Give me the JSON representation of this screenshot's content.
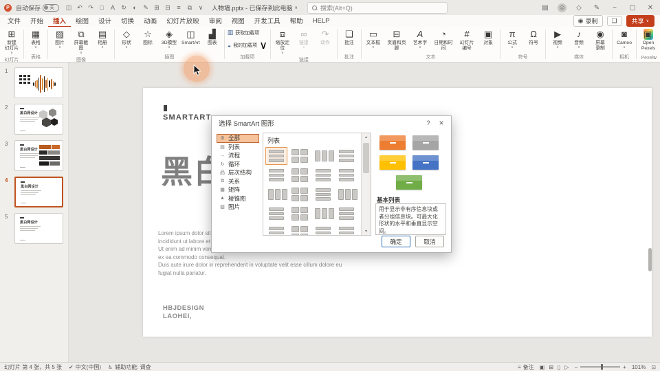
{
  "colors": {
    "accent": "#c43e1c",
    "selection": "#c0531f",
    "category_highlight": "#f6c39d",
    "dialog_primary_border": "#2f6fb8"
  },
  "titlebar": {
    "app_logo_letter": "P",
    "autosave_label": "自动保存",
    "autosave_state": "关",
    "quick_icons": [
      {
        "name": "save",
        "glyph": "◫"
      },
      {
        "name": "undo",
        "glyph": "↶"
      },
      {
        "name": "redo",
        "glyph": "↷"
      },
      {
        "name": "shape",
        "glyph": "□"
      },
      {
        "name": "text-box",
        "glyph": "A"
      },
      {
        "name": "rotate",
        "glyph": "↻"
      },
      {
        "name": "fill-color",
        "glyph": "◐"
      },
      {
        "name": "format-painter",
        "glyph": "✎"
      },
      {
        "name": "grid-view",
        "glyph": "⊞"
      },
      {
        "name": "guides",
        "glyph": "⊟"
      },
      {
        "name": "align",
        "glyph": "≡"
      },
      {
        "name": "arrange",
        "glyph": "⧉"
      },
      {
        "name": "more-commands",
        "glyph": "∨"
      }
    ],
    "doc_title": "人物墙.pptx - 已保存到此电脑",
    "doc_title_chevron": "∨",
    "search_placeholder": "搜索(Alt+Q)",
    "right_icons": [
      {
        "name": "ribbon-display",
        "glyph": "▤"
      },
      {
        "name": "account-avatar",
        "glyph": "☺"
      },
      {
        "name": "copilot",
        "glyph": "◇"
      },
      {
        "name": "editing-mode",
        "glyph": "✎"
      },
      {
        "name": "minimize",
        "glyph": "−"
      },
      {
        "name": "restore",
        "glyph": "▢"
      },
      {
        "name": "close",
        "glyph": "✕"
      }
    ]
  },
  "ribbon_tabs": {
    "items": [
      "文件",
      "开始",
      "插入",
      "绘图",
      "设计",
      "切换",
      "动画",
      "幻灯片放映",
      "审阅",
      "视图",
      "开发工具",
      "帮助",
      "HELP"
    ],
    "selected": "插入",
    "record_label": "录制",
    "record_icon": "◉",
    "comment_icon": "❏",
    "share_label": "共享",
    "share_chevron": "∨"
  },
  "icon_glyphs": {
    "new-slide": "⊞",
    "table": "▦",
    "picture": "▨",
    "screenshot": "⧉",
    "album": "▤",
    "shapes": "◇",
    "icons": "☆",
    "3d-model": "◈",
    "smartart": "◫",
    "chart": "▟",
    "get-addins": "▥",
    "my-addins": "◒",
    "zoom-link": "⧈",
    "link": "∞",
    "action": "↷",
    "comment": "❏",
    "textbox": "▭",
    "header-footer": "⊟",
    "wordart": "A",
    "datetime": "◔",
    "slide-number": "#",
    "object": "▣",
    "equation": "π",
    "symbol": "Ω",
    "video": "▶",
    "audio": "♪",
    "screen-record": "◉",
    "cameo": "◙",
    "open-pexels": "▣"
  },
  "ribbon": {
    "collapse_chevron": "∨",
    "groups": [
      {
        "label": "幻灯片",
        "buttons": [
          {
            "label": "新建\n幻灯片",
            "icon": "new-slide",
            "dropdown": true
          }
        ]
      },
      {
        "label": "表格",
        "buttons": [
          {
            "label": "表格",
            "icon": "table",
            "dropdown": true
          }
        ]
      },
      {
        "label": "图像",
        "buttons": [
          {
            "label": "图片",
            "icon": "picture",
            "dropdown": true
          },
          {
            "label": "屏幕截图",
            "icon": "screenshot",
            "dropdown": true
          },
          {
            "label": "相册",
            "icon": "album",
            "dropdown": true
          }
        ]
      },
      {
        "label": "插图",
        "buttons": [
          {
            "label": "形状",
            "icon": "shapes",
            "dropdown": true
          },
          {
            "label": "图标",
            "icon": "icons"
          },
          {
            "label": "3D模型",
            "icon": "3d-model",
            "dropdown": true
          },
          {
            "label": "SmartArt",
            "icon": "smartart"
          },
          {
            "label": "图表",
            "icon": "chart"
          }
        ]
      },
      {
        "label": "加载项",
        "stack": true,
        "buttons": [
          {
            "label": "获取加载项",
            "icon": "get-addins"
          },
          {
            "label": "我的加载项",
            "icon": "my-addins",
            "dropdown": true
          }
        ]
      },
      {
        "label": "链接",
        "buttons": [
          {
            "label": "缩放定位",
            "icon": "zoom-link",
            "dropdown": true
          },
          {
            "label": "链接",
            "icon": "link",
            "disabled": true,
            "dropdown": true
          },
          {
            "label": "动作",
            "icon": "action",
            "disabled": true
          }
        ]
      },
      {
        "label": "批注",
        "buttons": [
          {
            "label": "批注",
            "icon": "comment"
          }
        ]
      },
      {
        "label": "文本",
        "buttons": [
          {
            "label": "文本框",
            "icon": "textbox",
            "dropdown": true
          },
          {
            "label": "页眉和页脚",
            "icon": "header-footer"
          },
          {
            "label": "艺术字",
            "icon": "wordart",
            "dropdown": true
          },
          {
            "label": "日期和时间",
            "icon": "datetime"
          },
          {
            "label": "幻灯片\n编号",
            "icon": "slide-number"
          },
          {
            "label": "对象",
            "icon": "object"
          }
        ]
      },
      {
        "label": "符号",
        "buttons": [
          {
            "label": "公式",
            "icon": "equation",
            "dropdown": true
          },
          {
            "label": "符号",
            "icon": "symbol"
          }
        ]
      },
      {
        "label": "媒体",
        "buttons": [
          {
            "label": "视频",
            "icon": "video",
            "dropdown": true
          },
          {
            "label": "音频",
            "icon": "audio",
            "dropdown": true
          },
          {
            "label": "屏幕\n录制",
            "icon": "screen-record"
          }
        ]
      },
      {
        "label": "相机",
        "buttons": [
          {
            "label": "Cameo",
            "icon": "cameo",
            "dropdown": true
          }
        ]
      },
      {
        "label": "Pexels",
        "buttons": [
          {
            "label": "Open\nPexels",
            "icon": "open-pexels"
          }
        ]
      }
    ]
  },
  "slides_panel": {
    "selected": "4",
    "slides": [
      {
        "num": "1",
        "title": "",
        "type": "wave"
      },
      {
        "num": "2",
        "title": "黑白网设计",
        "type": "hex"
      },
      {
        "num": "3",
        "title": "黑白网设计",
        "type": "brick"
      },
      {
        "num": "4",
        "title": "黑白网设计",
        "type": "text"
      },
      {
        "num": "5",
        "title": "黑白网设计",
        "type": "text"
      }
    ]
  },
  "slide": {
    "heading": "SMARTART",
    "big_title": "黑白",
    "para1_lines": [
      "Lorem ipsum dolor sit amet, consectetur adipiscing elit, sed do eiusmod tempor",
      "incididunt ut labore et dolore magna aliqua.",
      "Ut enim ad minim veniam, quis nostrud exercitation ullamco laboris nisi ut aliquip",
      "ex ea commodo consequat."
    ],
    "para2_lines": [
      "Duis aute irure dolor in reprehenderit in voluptate velit esse cillum dolore eu",
      "fugiat nulla pariatur."
    ],
    "footer_line1": "HBJDESIGN",
    "footer_line2": "LAOHEI,"
  },
  "dialog": {
    "title": "选择 SmartArt 图形",
    "help_glyph": "?",
    "close_glyph": "✕",
    "selected_category": "全部",
    "categories": [
      {
        "label": "全部",
        "icon": "all",
        "glyph": "⊞"
      },
      {
        "label": "列表",
        "icon": "list",
        "glyph": "▤"
      },
      {
        "label": "流程",
        "icon": "process",
        "glyph": "→"
      },
      {
        "label": "循环",
        "icon": "cycle",
        "glyph": "↻"
      },
      {
        "label": "层次结构",
        "icon": "hierarchy",
        "glyph": "品"
      },
      {
        "label": "关系",
        "icon": "relationship",
        "glyph": "⧉"
      },
      {
        "label": "矩阵",
        "icon": "matrix",
        "glyph": "▦"
      },
      {
        "label": "棱锥图",
        "icon": "pyramid",
        "glyph": "▲"
      },
      {
        "label": "图片",
        "icon": "picture",
        "glyph": "▨"
      }
    ],
    "gallery": {
      "header": "列表",
      "cell_count": 20,
      "selected_index": 0,
      "scroll_up": "▴",
      "scroll_down": "▾"
    },
    "preview": {
      "title": "基本列表",
      "description": "用于显示非有序信息块或者分组信息块。可最大化形状的水平和垂直显示空间。",
      "box_colors": [
        "#ed7d31",
        "#a5a5a5",
        "#ffc000",
        "#4472c4",
        "#70ad47"
      ]
    },
    "ok_label": "确定",
    "cancel_label": "取消"
  },
  "statusbar": {
    "slide_info": "幻灯片 第 4 张，共 5 张",
    "spell_icon": "✔",
    "language": "中文(中国)",
    "accessibility_icon": "♿",
    "accessibility": "辅助功能: 调查",
    "notes_icon": "≡",
    "notes_label": "备注",
    "view_icons": [
      {
        "name": "normal-view",
        "glyph": "▣"
      },
      {
        "name": "slide-sorter-view",
        "glyph": "⊞"
      },
      {
        "name": "reading-view",
        "glyph": "▯"
      },
      {
        "name": "slideshow-view",
        "glyph": "▷"
      }
    ],
    "zoom_minus": "−",
    "zoom_plus": "+",
    "zoom_percent": "101%",
    "fit_icon": "⊡"
  }
}
